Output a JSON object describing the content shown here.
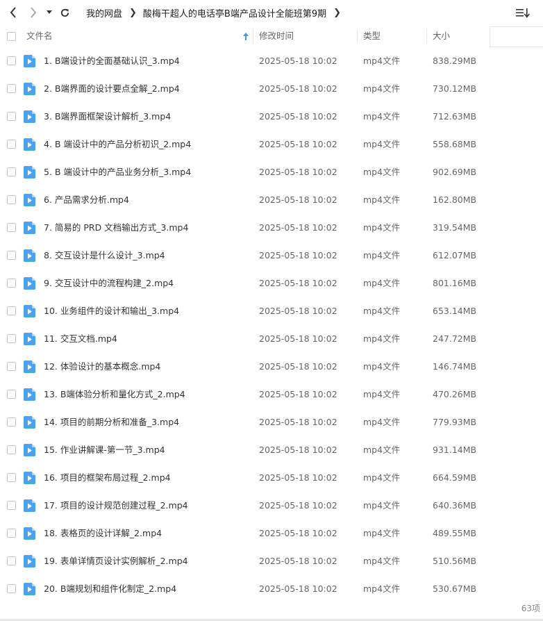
{
  "toolbar": {
    "breadcrumb": [
      "我的网盘",
      "酸梅干超人的电话亭B端产品设计全能班第9期"
    ]
  },
  "columns": {
    "name": "文件名",
    "modified": "修改时间",
    "type": "类型",
    "size": "大小"
  },
  "colors": {
    "accent": "#3b9cf0",
    "icon": "#4aa3ee"
  },
  "files": [
    {
      "name": "1. B端设计的全面基础认识_3.mp4",
      "modified": "2025-05-18 10:02",
      "type": "mp4文件",
      "size": "838.29MB"
    },
    {
      "name": "2. B端界面的设计要点全解_2.mp4",
      "modified": "2025-05-18 10:02",
      "type": "mp4文件",
      "size": "730.12MB"
    },
    {
      "name": "3. B端界面框架设计解析_3.mp4",
      "modified": "2025-05-18 10:02",
      "type": "mp4文件",
      "size": "712.63MB"
    },
    {
      "name": "4. B 端设计中的产品分析初识_2.mp4",
      "modified": "2025-05-18 10:02",
      "type": "mp4文件",
      "size": "558.68MB"
    },
    {
      "name": "5. B 端设计中的产品业务分析_3.mp4",
      "modified": "2025-05-18 10:02",
      "type": "mp4文件",
      "size": "902.69MB"
    },
    {
      "name": "6. 产品需求分析.mp4",
      "modified": "2025-05-18 10:02",
      "type": "mp4文件",
      "size": "162.80MB"
    },
    {
      "name": "7. 简易的 PRD 文档输出方式_3.mp4",
      "modified": "2025-05-18 10:02",
      "type": "mp4文件",
      "size": "319.54MB"
    },
    {
      "name": "8. 交互设计是什么设计_3.mp4",
      "modified": "2025-05-18 10:02",
      "type": "mp4文件",
      "size": "612.07MB"
    },
    {
      "name": "9. 交互设计中的流程构建_2.mp4",
      "modified": "2025-05-18 10:02",
      "type": "mp4文件",
      "size": "801.16MB"
    },
    {
      "name": "10. 业务组件的设计和输出_3.mp4",
      "modified": "2025-05-18 10:02",
      "type": "mp4文件",
      "size": "653.14MB"
    },
    {
      "name": "11. 交互文档.mp4",
      "modified": "2025-05-18 10:02",
      "type": "mp4文件",
      "size": "247.72MB"
    },
    {
      "name": "12. 体验设计的基本概念.mp4",
      "modified": "2025-05-18 10:02",
      "type": "mp4文件",
      "size": "146.74MB"
    },
    {
      "name": "13. B端体验分析和量化方式_2.mp4",
      "modified": "2025-05-18 10:02",
      "type": "mp4文件",
      "size": "470.26MB"
    },
    {
      "name": "14. 项目的前期分析和准备_3.mp4",
      "modified": "2025-05-18 10:02",
      "type": "mp4文件",
      "size": "779.93MB"
    },
    {
      "name": "15. 作业讲解课-第一节_3.mp4",
      "modified": "2025-05-18 10:02",
      "type": "mp4文件",
      "size": "931.14MB"
    },
    {
      "name": "16. 项目的框架布局过程_2.mp4",
      "modified": "2025-05-18 10:02",
      "type": "mp4文件",
      "size": "664.59MB"
    },
    {
      "name": "17. 项目的设计规范创建过程_2.mp4",
      "modified": "2025-05-18 10:02",
      "type": "mp4文件",
      "size": "640.36MB"
    },
    {
      "name": "18. 表格页的设计详解_2.mp4",
      "modified": "2025-05-18 10:02",
      "type": "mp4文件",
      "size": "489.55MB"
    },
    {
      "name": "19. 表单详情页设计实例解析_2.mp4",
      "modified": "2025-05-18 10:02",
      "type": "mp4文件",
      "size": "510.56MB"
    },
    {
      "name": "20. B端规划和组件化制定_2.mp4",
      "modified": "2025-05-18 10:02",
      "type": "mp4文件",
      "size": "530.67MB"
    }
  ],
  "footer": {
    "count": "63项"
  }
}
